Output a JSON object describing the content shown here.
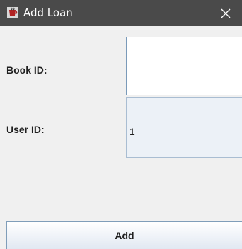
{
  "window": {
    "title": "Add Loan",
    "app_icon": "coffee-cup-icon",
    "close_icon": "close-icon"
  },
  "form": {
    "book_id_label": "Book ID:",
    "book_id_value": "",
    "user_id_label": "User ID:",
    "user_id_value": "1"
  },
  "actions": {
    "add_label": "Add"
  },
  "colors": {
    "titlebar": "#4a4a4a",
    "window_bg": "#f0f0f0",
    "field_border": "#7a9ab9",
    "readonly_bg": "#ecf1f7"
  }
}
